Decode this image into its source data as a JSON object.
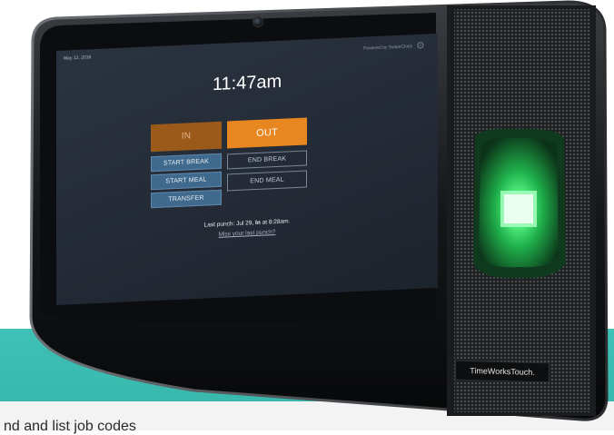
{
  "screen": {
    "date": "May 12, 2016",
    "powered_by": "Powered by SwipeClock",
    "icons": {
      "settings": "gear-icon"
    },
    "time": "11:47am",
    "buttons": {
      "in": "IN",
      "out": "OUT",
      "start_break": "START BREAK",
      "end_break": "END BREAK",
      "start_meal": "START MEAL",
      "end_meal": "END MEAL",
      "transfer": "TRANSFER"
    },
    "last_punch_prefix": "Last punch: Jul 29, ",
    "last_punch_type": "In",
    "last_punch_suffix": " at 8:28am.",
    "miss_link": "Miss your last punch?"
  },
  "device": {
    "brand": "TimeWorksTouch."
  },
  "page": {
    "cut_text": "nd and list job codes"
  },
  "colors": {
    "teal_band": "#3fc1b6",
    "screen_bg": "#2b3340",
    "in_button": "#9c5a1a",
    "out_button": "#e8861f",
    "blue_button": "#3f6a8e",
    "sensor_glow": "#35ff6a"
  }
}
